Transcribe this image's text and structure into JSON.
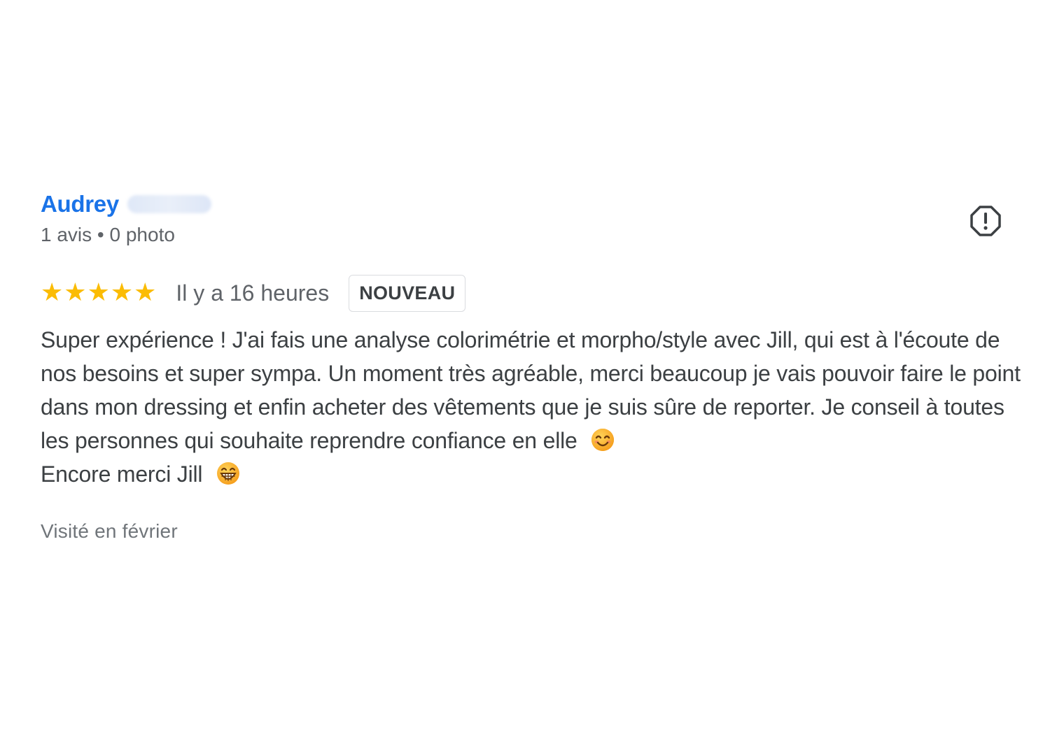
{
  "reviewer": {
    "name": "Audrey",
    "meta": "1 avis • 0 photo"
  },
  "rating": {
    "stars": 5,
    "max_stars": 5,
    "star_glyph": "★",
    "star_color": "#fbbc04",
    "time_ago": "Il y a 16 heures",
    "badge": "NOUVEAU"
  },
  "review": {
    "text_part1": "Super expérience ! J'ai fais une analyse colorimétrie et morpho/style avec Jill, qui est à l'écoute de nos besoins et super sympa. Un moment très agréable, merci beaucoup je vais pouvoir faire le point dans mon dressing et enfin acheter des vêtements que je suis sûre de reporter. Je conseil à toutes les personnes qui souhaite reprendre confiance en elle",
    "emoji1": "smiling-face-icon",
    "text_part2": "Encore merci Jill",
    "emoji2": "grinning-face-icon"
  },
  "visit": {
    "label": "Visité en février"
  },
  "icons": {
    "report": "report-icon"
  },
  "colors": {
    "name": "#1a73e8",
    "text": "#3c4043",
    "muted": "#5f6368"
  }
}
